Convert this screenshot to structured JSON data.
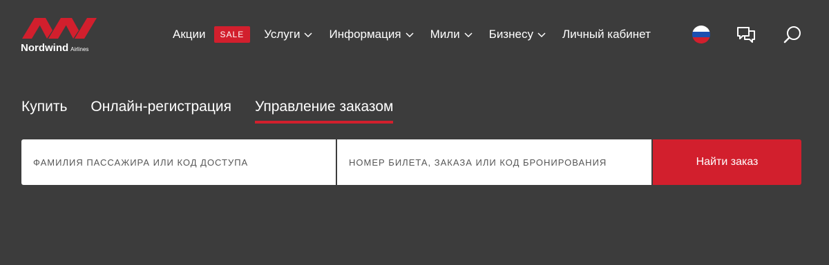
{
  "brand": {
    "name": "Nordwind",
    "suffix": "Airlines",
    "accent_color": "#d21f2d",
    "background_color": "#3c3c3c"
  },
  "nav": {
    "items": [
      {
        "label": "Акции",
        "has_dropdown": false
      },
      {
        "label": "Услуги",
        "has_dropdown": true
      },
      {
        "label": "Информация",
        "has_dropdown": true
      },
      {
        "label": "Мили",
        "has_dropdown": true
      },
      {
        "label": "Бизнесу",
        "has_dropdown": true
      },
      {
        "label": "Личный кабинет",
        "has_dropdown": false
      }
    ],
    "sale_badge": "SALE"
  },
  "header_icons": {
    "language": "russian-flag-icon",
    "chat": "chat-icon",
    "search": "search-icon"
  },
  "tabs": [
    {
      "label": "Купить",
      "active": false
    },
    {
      "label": "Онлайн-регистрация",
      "active": false
    },
    {
      "label": "Управление заказом",
      "active": true
    }
  ],
  "search_form": {
    "field1_placeholder": "ФАМИЛИЯ ПАССАЖИРА ИЛИ КОД ДОСТУПА",
    "field2_placeholder": "НОМЕР БИЛЕТА, ЗАКАЗА ИЛИ КОД БРОНИРОВАНИЯ",
    "submit_label": "Найти заказ"
  }
}
